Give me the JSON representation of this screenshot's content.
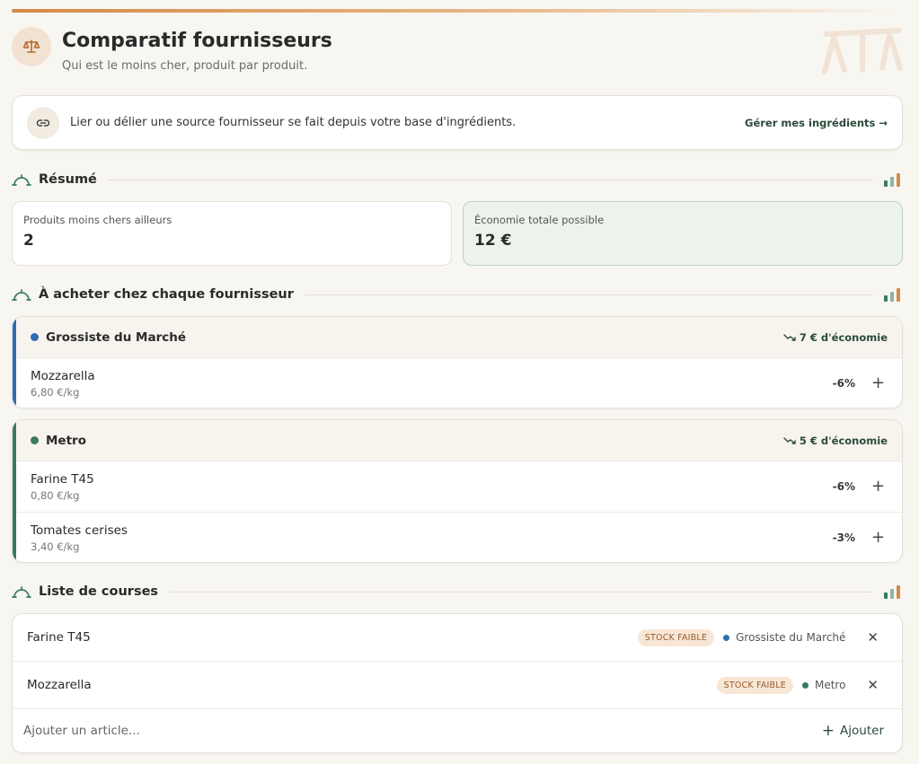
{
  "header": {
    "title": "Comparatif fournisseurs",
    "subtitle": "Qui est le moins cher, produit par produit."
  },
  "info": {
    "text": "Lier ou délier une source fournisseur se fait depuis votre base d'ingrédients.",
    "link_label": "Gérer mes ingrédients →"
  },
  "summary": {
    "title": "Résumé",
    "cheaper_label": "Produits moins chers ailleurs",
    "cheaper_value": "2",
    "savings_label": "Économie totale possible",
    "savings_value": "12 €"
  },
  "buy": {
    "title": "À acheter chez chaque fournisseur",
    "suppliers": [
      {
        "name": "Grossiste du Marché",
        "color": "#2f6db3",
        "saving": "7 € d'économie",
        "products": [
          {
            "name": "Mozzarella",
            "price": "6,80 €/kg",
            "pct": "-6%"
          }
        ]
      },
      {
        "name": "Metro",
        "color": "#3b7a60",
        "saving": "5 € d'économie",
        "products": [
          {
            "name": "Farine T45",
            "price": "0,80 €/kg",
            "pct": "-6%"
          },
          {
            "name": "Tomates cerises",
            "price": "3,40 €/kg",
            "pct": "-3%"
          }
        ]
      }
    ]
  },
  "shopping": {
    "title": "Liste de courses",
    "items": [
      {
        "name": "Farine T45",
        "badge": "STOCK FAIBLE",
        "supplier": "Grossiste du Marché",
        "supplier_color": "#2f6db3"
      },
      {
        "name": "Mozzarella",
        "badge": "STOCK FAIBLE",
        "supplier": "Metro",
        "supplier_color": "#3b7a60"
      }
    ],
    "add_placeholder": "Ajouter un article...",
    "add_label": "Ajouter"
  },
  "colors": {
    "accent_orange": "#d48a47",
    "accent_green": "#3b7a60",
    "blue": "#2f6db3"
  }
}
